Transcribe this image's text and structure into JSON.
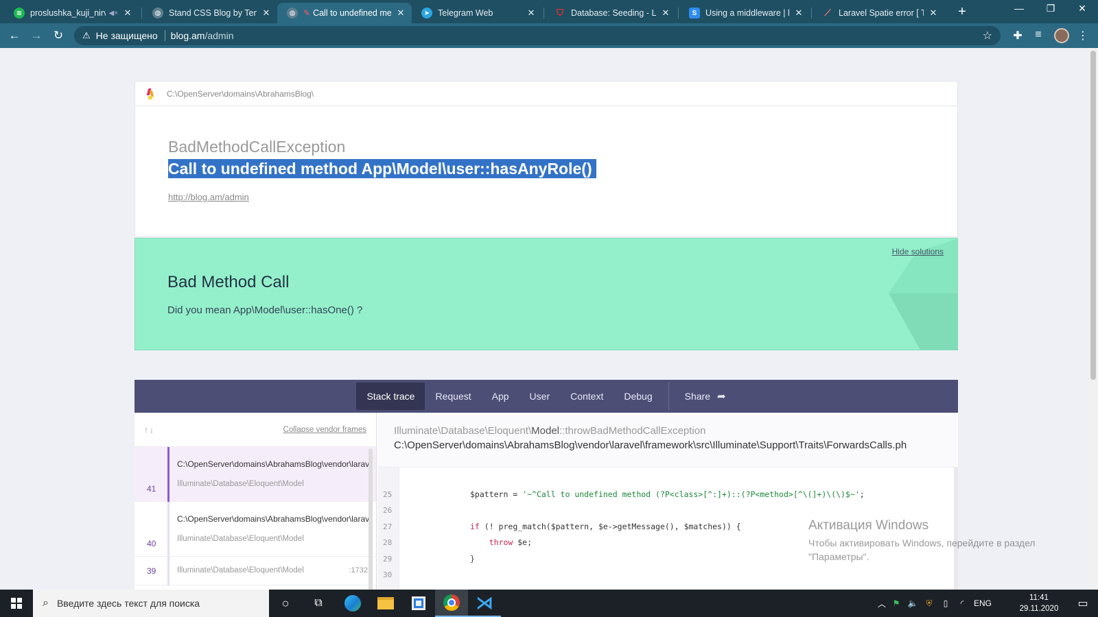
{
  "browser": {
    "tabs": [
      {
        "label": "proslushka_kuji_nirvana",
        "favicon": "spotify",
        "color": "#1db954",
        "active": false,
        "muted": true
      },
      {
        "label": "Stand CSS Blog by Templ",
        "favicon": "globe",
        "color": "#5f7f8e",
        "active": false
      },
      {
        "label": "Call to undefined me",
        "favicon": "globe",
        "color": "#5f7f8e",
        "active": true
      },
      {
        "label": "Telegram Web",
        "favicon": "telegram",
        "color": "#2ca5e0",
        "active": false
      },
      {
        "label": "Database: Seeding - Lara",
        "favicon": "laravel",
        "color": "#ff2d20",
        "active": false
      },
      {
        "label": "Using a middleware | lara",
        "favicon": "s",
        "color": "#2d8cf0",
        "active": false
      },
      {
        "label": "Laravel Spatie error [ Tar",
        "favicon": "laravel",
        "color": "#ff2d20",
        "active": false
      }
    ],
    "address": {
      "security_label": "Не защищено",
      "host": "blog.am",
      "path": "/admin"
    }
  },
  "page": {
    "project_path": "C:\\OpenServer\\domains\\AbrahamsBlog\\",
    "exception_class": "BadMethodCallException",
    "exception_message": "Call to undefined method App\\Model\\user::hasAnyRole()",
    "request_url": "http://blog.am/admin",
    "solution": {
      "hide_label": "Hide solutions",
      "title": "Bad Method Call",
      "text": "Did you mean App\\Model\\user::hasOne() ?"
    },
    "nav": {
      "items": [
        "Stack trace",
        "Request",
        "App",
        "User",
        "Context",
        "Debug"
      ],
      "share": "Share"
    },
    "frames": {
      "collapse_label": "Collapse vendor frames",
      "items": [
        {
          "number": "41",
          "path": "C:\\OpenServer\\domains\\AbrahamsBlog\\vendor\\laravel",
          "class": "Illuminate\\Database\\Eloquent\\Model",
          "line": ""
        },
        {
          "number": "40",
          "path": "C:\\OpenServer\\domains\\AbrahamsBlog\\vendor\\laravel",
          "class": "Illuminate\\Database\\Eloquent\\Model",
          "line": ""
        },
        {
          "number": "39",
          "path": "",
          "class": "Illuminate\\Database\\Eloquent\\Model",
          "line": ":1732"
        }
      ]
    },
    "code": {
      "class_prefix": "Illuminate\\Database\\Eloquent\\",
      "class_name": "Model",
      "method": "::throwBadMethodCallException",
      "file": "C:\\OpenServer\\domains\\AbrahamsBlog\\vendor\\laravel\\framework\\src\\Illuminate\\Support\\Traits\\ForwardsCalls.ph",
      "lines": [
        {
          "n": "25",
          "text": "$pattern = '~^Call to undefined method (?P<class>[^:]+)::(?P<method>[^\\(]+)\\(\\)$~';"
        },
        {
          "n": "26",
          "text": ""
        },
        {
          "n": "27",
          "text": "if (! preg_match($pattern, $e->getMessage(), $matches)) {"
        },
        {
          "n": "28",
          "text": "    throw $e;"
        },
        {
          "n": "29",
          "text": "}"
        },
        {
          "n": "30",
          "text": ""
        }
      ]
    },
    "activation": {
      "title": "Активация Windows",
      "line1": "Чтобы активировать Windows, перейдите в раздел",
      "line2": "\"Параметры\"."
    }
  },
  "taskbar": {
    "search_placeholder": "Введите здесь текст для поиска",
    "language": "ENG",
    "time": "11:41",
    "date": "29.11.2020"
  }
}
